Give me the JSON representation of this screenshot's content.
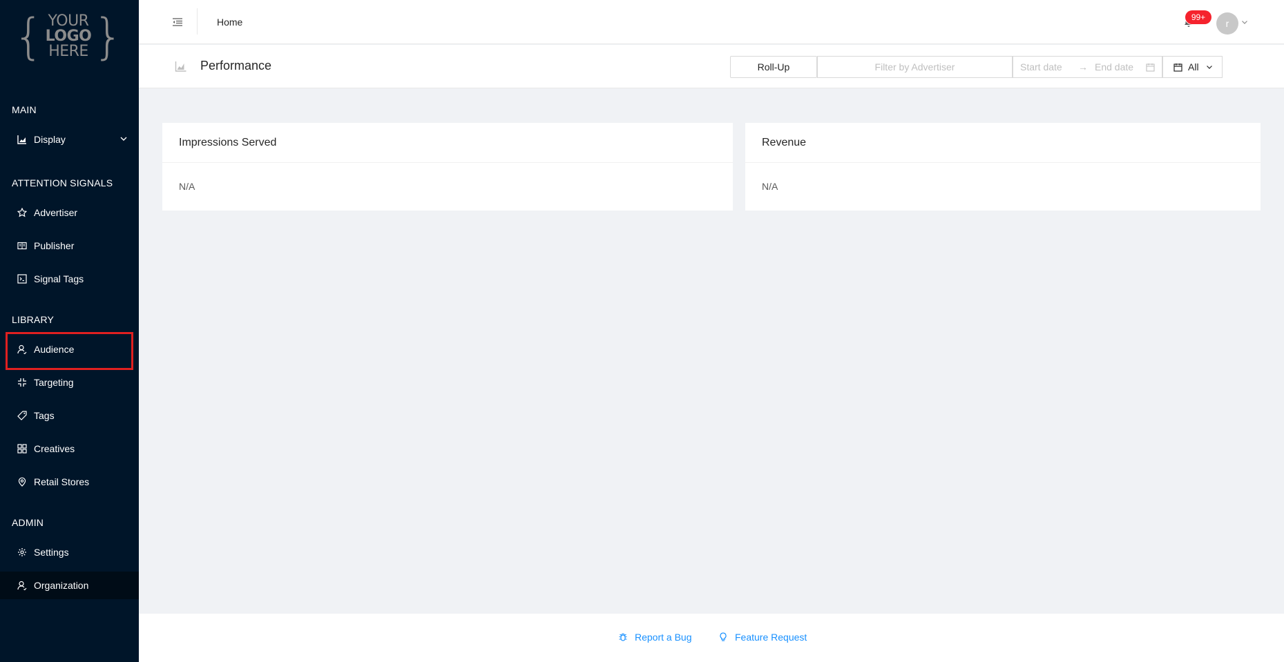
{
  "logo": {
    "line1": "YOUR",
    "line2": "LOGO",
    "line3": "HERE"
  },
  "sidebar": {
    "groups": [
      {
        "title": "MAIN"
      },
      {
        "title": "ATTENTION SIGNALS"
      },
      {
        "title": "LIBRARY"
      },
      {
        "title": "ADMIN"
      }
    ],
    "items": [
      {
        "label": "Display",
        "icon": "area-chart-icon"
      },
      {
        "label": "Advertiser",
        "icon": "star-icon"
      },
      {
        "label": "Publisher",
        "icon": "read-icon"
      },
      {
        "label": "Signal Tags",
        "icon": "code-icon"
      },
      {
        "label": "Audience",
        "icon": "user-icon"
      },
      {
        "label": "Targeting",
        "icon": "compress-icon"
      },
      {
        "label": "Tags",
        "icon": "tag-icon"
      },
      {
        "label": "Creatives",
        "icon": "appstore-icon"
      },
      {
        "label": "Retail Stores",
        "icon": "map-pin-icon"
      },
      {
        "label": "Settings",
        "icon": "gear-icon"
      },
      {
        "label": "Organization",
        "icon": "team-icon"
      }
    ]
  },
  "header": {
    "breadcrumb": "Home",
    "notification_count": "99+",
    "avatar_initial": "r"
  },
  "page": {
    "title": "Performance",
    "rollup_label": "Roll-Up",
    "filter_placeholder": "Filter by Advertiser",
    "start_placeholder": "Start date",
    "end_placeholder": "End date",
    "range_arrow": "→",
    "preset_label": "All"
  },
  "cards": {
    "impressions": {
      "title": "Impressions Served",
      "value": "N/A"
    },
    "revenue": {
      "title": "Revenue",
      "value": "N/A"
    }
  },
  "footer": {
    "report_bug": "Report a Bug",
    "feature_request": "Feature Request"
  },
  "colors": {
    "sidebar_bg": "#001529",
    "selected_bg": "#000c17",
    "link": "#1890ff",
    "badge": "#f5222d",
    "highlight": "#e02020"
  }
}
